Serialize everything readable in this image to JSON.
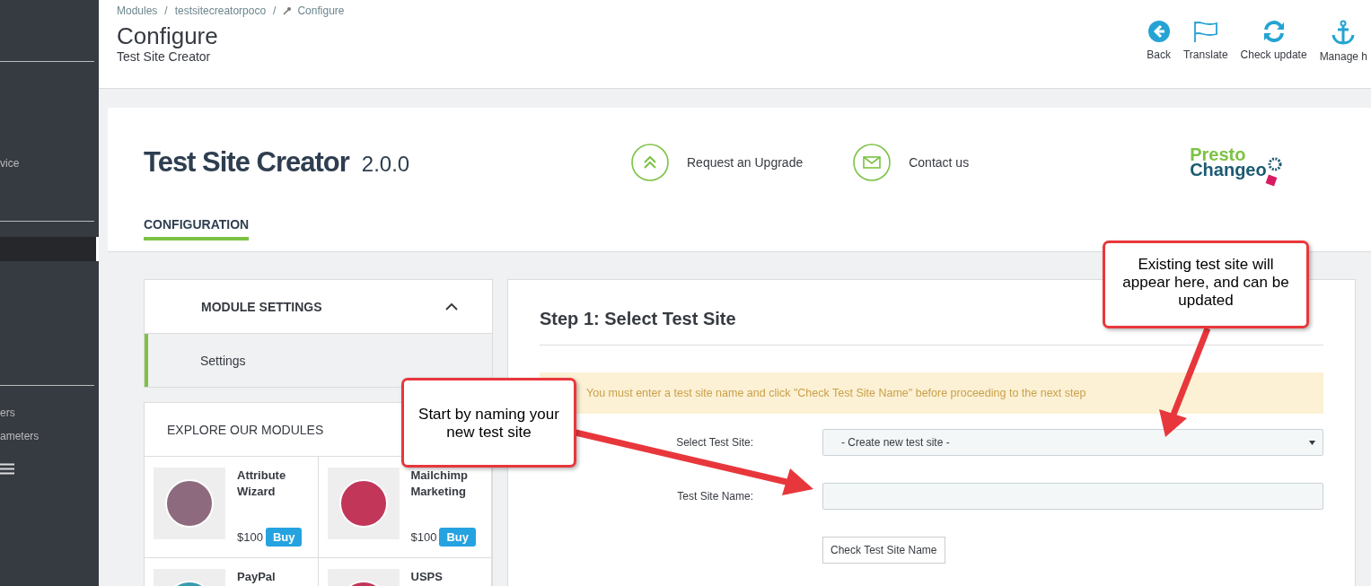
{
  "sidebar": {
    "items": [
      {
        "label": "vice",
        "selected": false
      },
      {
        "selected": true
      },
      {
        "label": "ers",
        "selected": false
      },
      {
        "label": "ameters",
        "selected": false
      }
    ]
  },
  "header": {
    "breadcrumbs": [
      "Modules",
      "testsitecreatorpoco",
      "Configure"
    ],
    "separator": "/",
    "title": "Configure",
    "subtitle": "Test Site Creator",
    "toolbar": [
      {
        "kind": "back",
        "label": "Back"
      },
      {
        "kind": "flag",
        "label": "Translate"
      },
      {
        "kind": "refresh",
        "label": "Check update"
      },
      {
        "kind": "anchor",
        "label": "Manage h"
      }
    ]
  },
  "module": {
    "name": "Test Site Creator",
    "version": "2.0.0",
    "links": [
      {
        "kind": "upgrade",
        "label": "Request an Upgrade"
      },
      {
        "kind": "mail",
        "label": "Contact us"
      }
    ],
    "logo": [
      "Presto",
      "Changeo"
    ],
    "tabs": [
      {
        "label": "CONFIGURATION",
        "selected": true
      }
    ]
  },
  "settings_menu": {
    "title": "MODULE SETTINGS",
    "expanded": true,
    "items": [
      {
        "label": "Settings",
        "selected": true
      }
    ]
  },
  "explore": {
    "title": "EXPLORE OUR MODULES",
    "modules": [
      {
        "name": "Attribute Wizard",
        "price": "$100",
        "button": "Buy",
        "color": "#8e6a7f"
      },
      {
        "name": "Mailchimp Marketing",
        "price": "$100",
        "button": "Buy",
        "color": "#c2365a"
      },
      {
        "name": "PayPal",
        "color": "#3a9bb0"
      },
      {
        "name": "USPS",
        "color": "#c2365a"
      }
    ]
  },
  "step": {
    "title": "Step 1: Select Test Site",
    "alert": "You must enter a test site name and click \"Check Test Site Name\" before proceeding to the next step",
    "fields": [
      {
        "kind": "select",
        "label": "Select Test Site:",
        "value": "- Create new test site -"
      },
      {
        "kind": "text",
        "label": "Test Site Name:"
      }
    ],
    "button": "Check Test Site Name"
  },
  "callouts": [
    {
      "text": "Existing test site will appear here, and can be updated"
    },
    {
      "text": "Start by naming your new test site"
    }
  ]
}
